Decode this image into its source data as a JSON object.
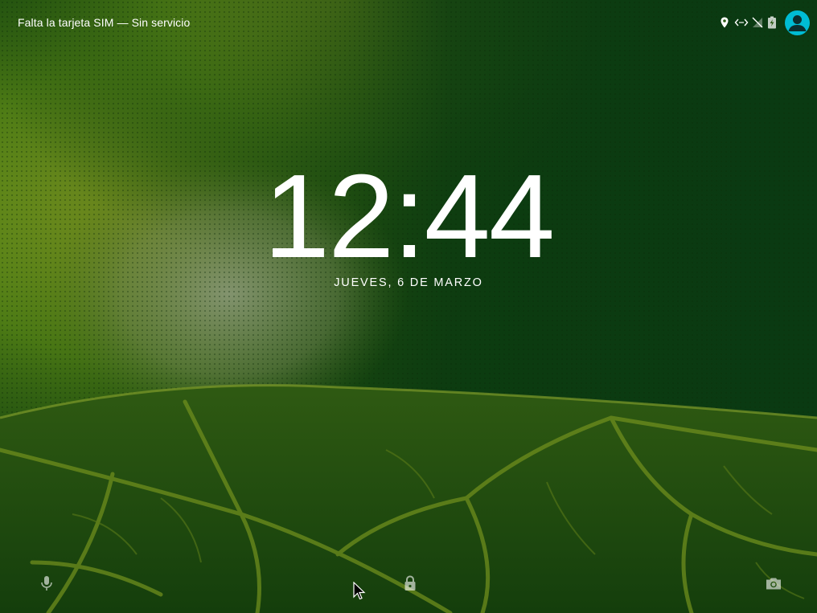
{
  "status_bar": {
    "carrier_text": "Falta la tarjeta SIM — Sin servicio",
    "icons": [
      "location-icon",
      "data-sync-icon",
      "no-signal-icon",
      "battery-charging-icon"
    ],
    "avatar_color": "#00bcd4"
  },
  "lockscreen": {
    "time": "12:44",
    "date": "JUEVES, 6 DE MARZO"
  },
  "bottom_bar": {
    "left_icon": "microphone-icon",
    "center_icon": "lock-icon",
    "right_icon": "camera-icon"
  },
  "colors": {
    "wallpaper_dark": "#0e3a0c",
    "wallpaper_mid": "#2c6a14",
    "wallpaper_light": "#7ea21a",
    "vein": "#6a8a1c",
    "text": "#ffffff"
  }
}
